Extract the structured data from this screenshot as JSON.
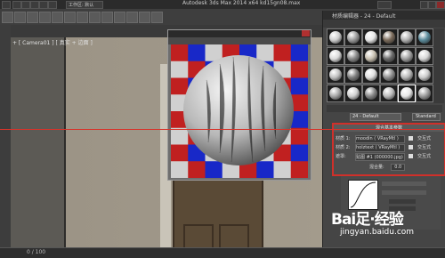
{
  "app": {
    "window_title": "Autodesk 3ds Max  2014 x64     kd15gn08.max",
    "titlebar_workspace": "工作区: 默认"
  },
  "viewport": {
    "label": "+ [ Camera01 ] [ 真实 + 边面 ]"
  },
  "status": {
    "text": "0 / 100"
  },
  "material_editor": {
    "title": "材质编辑器 - 24 - Default",
    "material_name": "24 - Default",
    "type_button": "Standard",
    "params_title": "混合基本参数",
    "rows": [
      {
        "label": "材质 1:",
        "value": "moodin ( VRayMtl )",
        "btn": "交互式"
      },
      {
        "label": "材质 2:",
        "value": "holztext ( VRayMtl )",
        "btn": "交互式"
      },
      {
        "label": "遮罩:",
        "value": "贴图 #1 (000000.jpg)",
        "btn": "交互式"
      }
    ],
    "mix_label": "混合量:",
    "mix_value": "0.0"
  },
  "watermark": {
    "logo": "Bai足·经验",
    "url": "jingyan.baidu.com"
  },
  "colors": {
    "accent_red": "#d0302a",
    "checker_red": "#c02020",
    "checker_green": "#10a020",
    "checker_blue": "#1828c8",
    "checker_grey": "#808080"
  },
  "icons": [
    "close-icon",
    "sphere-icon",
    "minimize-icon",
    "maximize-icon"
  ]
}
